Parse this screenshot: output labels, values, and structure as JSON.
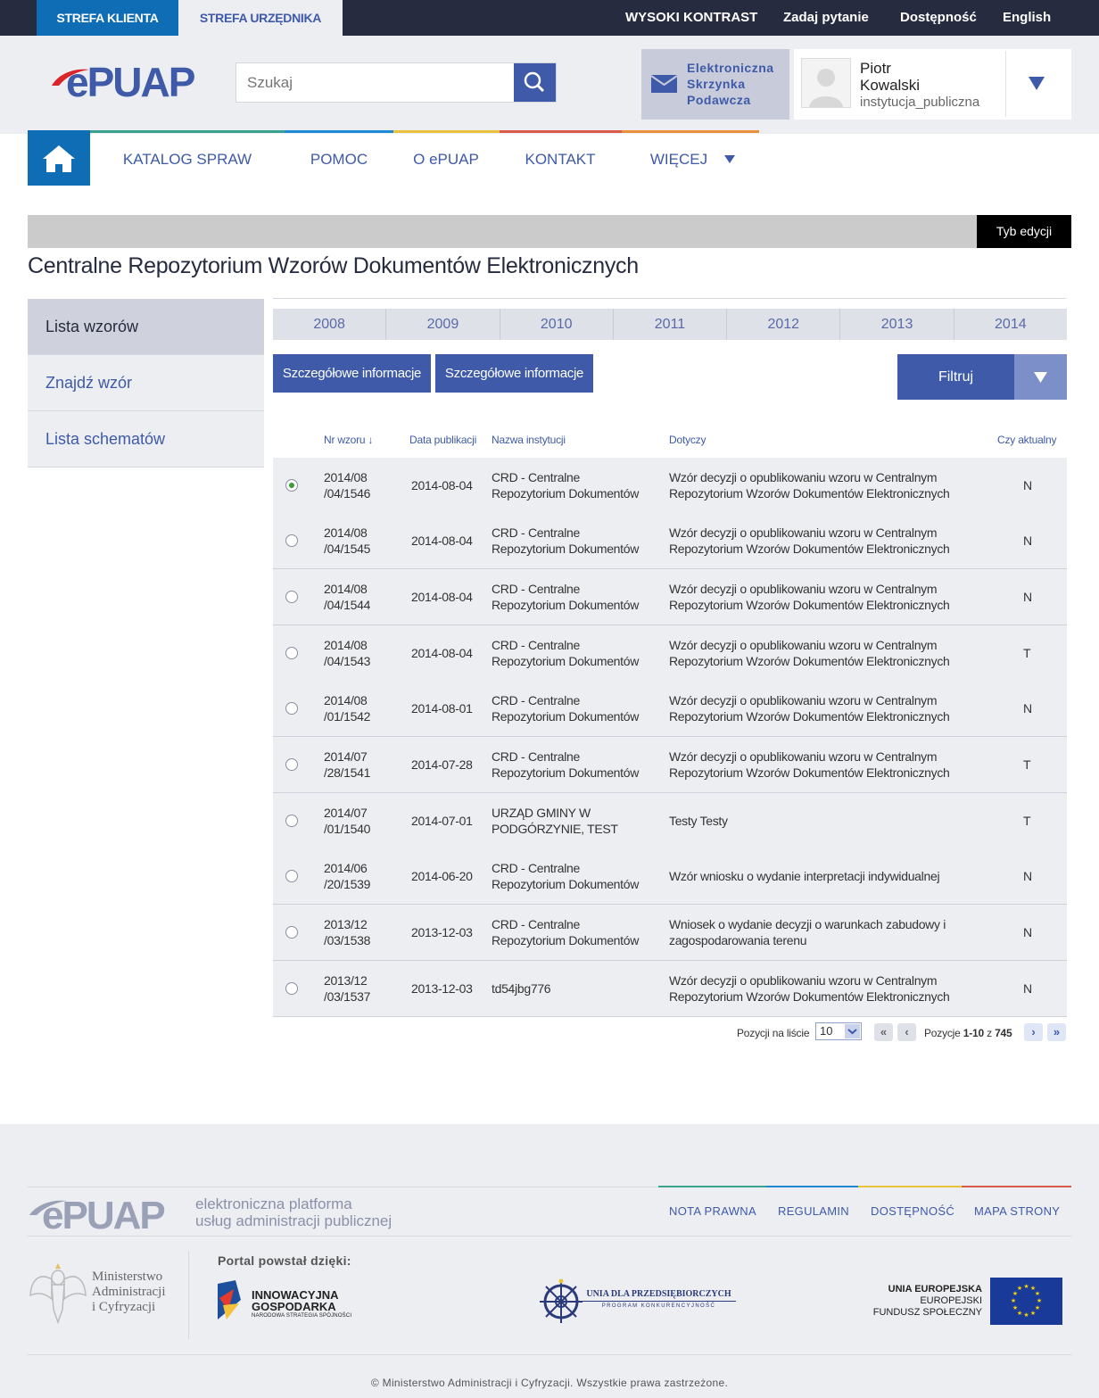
{
  "topbar": {
    "client_zone": "STREFA KLIENTA",
    "official_zone": "STREFA URZĘDNIKA",
    "high_contrast": "WYSOKI KONTRAST",
    "ask_question": "Zadaj pytanie",
    "accessibility": "Dostępność",
    "english": "English"
  },
  "header": {
    "search_placeholder": "Szukaj",
    "inbox_line1": "Elektroniczna",
    "inbox_line2": "Skrzynka",
    "inbox_line3": "Podawcza",
    "user_first": "Piotr",
    "user_last": "Kowalski",
    "user_role": "instytucja_publiczna"
  },
  "nav": {
    "items": [
      "KATALOG SPRAW",
      "POMOC",
      "O ePUAP",
      "KONTAKT",
      "WIĘCEJ"
    ]
  },
  "edit_mode": "Tyb edycji",
  "page_title": "Centralne Repozytorium Wzorów Dokumentów Elektronicznych",
  "sidebar": [
    "Lista wzorów",
    "Znajdź wzór",
    "Lista schematów"
  ],
  "years": [
    "2008",
    "2009",
    "2010",
    "2011",
    "2012",
    "2013",
    "2014"
  ],
  "buttons": {
    "details1": "Szczegółowe informacje",
    "details2": "Szczegółowe informacje",
    "filter": "Filtruj"
  },
  "table": {
    "headers": [
      "Nr wzoru ↓",
      "Data publikacji",
      "Nazwa instytucji",
      "Dotyczy",
      "Czy aktualny"
    ],
    "rows": [
      {
        "nr1": "2014/08",
        "nr2": "/04/1546",
        "date": "2014-08-04",
        "inst1": "CRD - Centralne",
        "inst2": "Repozytorium Dokumentów",
        "sub1": "Wzór decyzji o opublikowaniu wzoru w Centralnym",
        "sub2": "Repozytorium Wzorów Dokumentów Elektronicznych",
        "current": "N",
        "selected": true
      },
      {
        "nr1": "2014/08",
        "nr2": "/04/1545",
        "date": "2014-08-04",
        "inst1": "CRD - Centralne",
        "inst2": "Repozytorium Dokumentów",
        "sub1": "Wzór decyzji o opublikowaniu wzoru w Centralnym",
        "sub2": "Repozytorium Wzorów Dokumentów Elektronicznych",
        "current": "N"
      },
      {
        "nr1": "2014/08",
        "nr2": "/04/1544",
        "date": "2014-08-04",
        "inst1": "CRD - Centralne",
        "inst2": "Repozytorium Dokumentów",
        "sub1": "Wzór decyzji o opublikowaniu wzoru w Centralnym",
        "sub2": "Repozytorium Wzorów Dokumentów Elektronicznych",
        "current": "N"
      },
      {
        "nr1": "2014/08",
        "nr2": "/04/1543",
        "date": "2014-08-04",
        "inst1": "CRD - Centralne",
        "inst2": "Repozytorium Dokumentów",
        "sub1": "Wzór decyzji o opublikowaniu wzoru w Centralnym",
        "sub2": "Repozytorium Wzorów Dokumentów Elektronicznych",
        "current": "T"
      },
      {
        "nr1": "2014/08",
        "nr2": "/01/1542",
        "date": "2014-08-01",
        "inst1": "CRD - Centralne",
        "inst2": "Repozytorium Dokumentów",
        "sub1": "Wzór decyzji o opublikowaniu wzoru w Centralnym",
        "sub2": "Repozytorium Wzorów Dokumentów Elektronicznych",
        "current": "N"
      },
      {
        "nr1": "2014/07",
        "nr2": "/28/1541",
        "date": "2014-07-28",
        "inst1": "CRD - Centralne",
        "inst2": "Repozytorium Dokumentów",
        "sub1": "Wzór decyzji o opublikowaniu wzoru w Centralnym",
        "sub2": "Repozytorium Wzorów Dokumentów Elektronicznych",
        "current": "T"
      },
      {
        "nr1": "2014/07",
        "nr2": "/01/1540",
        "date": "2014-07-01",
        "inst1": "URZĄD GMINY W",
        "inst2": "PODGÓRZYNIE, TEST",
        "sub1": "Testy Testy",
        "sub2": "",
        "current": "T"
      },
      {
        "nr1": "2014/06",
        "nr2": "/20/1539",
        "date": "2014-06-20",
        "inst1": "CRD - Centralne",
        "inst2": "Repozytorium Dokumentów",
        "sub1": "Wzór wniosku o wydanie interpretacji indywidualnej",
        "sub2": "",
        "current": "N"
      },
      {
        "nr1": "2013/12",
        "nr2": "/03/1538",
        "date": "2013-12-03",
        "inst1": "CRD - Centralne",
        "inst2": "Repozytorium Dokumentów",
        "sub1": "Wniosek o wydanie decyzji o warunkach zabudowy i",
        "sub2": "zagospodarowania terenu",
        "current": "N"
      },
      {
        "nr1": "2013/12",
        "nr2": "/03/1537",
        "date": "2013-12-03",
        "inst1": "td54jbg776",
        "inst2": "",
        "sub1": "Wzór decyzji o opublikowaniu wzoru w Centralnym",
        "sub2": "Repozytorium Wzorów Dokumentów Elektronicznych",
        "current": "N"
      }
    ]
  },
  "pager": {
    "per_page_label": "Pozycji na liście",
    "per_page_value": "10",
    "positions_label": "Pozycje",
    "positions_range": "1-10",
    "of": "z",
    "total": "745"
  },
  "footer": {
    "tagline1": "elektroniczna platforma",
    "tagline2": "usług administracji publicznej",
    "links": [
      "NOTA PRAWNA",
      "REGULAMIN",
      "DOSTĘPNOŚĆ",
      "MAPA STRONY"
    ],
    "ministry1": "Ministerstwo",
    "ministry2": "Administracji",
    "ministry3": "i Cyfryzacji",
    "portal_label": "Portal powstał dzięki:",
    "ig1": "INNOWACYJNA",
    "ig2": "GOSPODARKA",
    "ig3": "NARODOWA STRATEGIA SPÓJNOŚCI",
    "udp1": "UNIA DLA PRZEDSIĘBIORCZYCH",
    "udp2": "PROGRAM KONKURENCYJNOŚĆ",
    "eu1": "UNIA EUROPEJSKA",
    "eu2": "EUROPEJSKI",
    "eu3": "FUNDUSZ SPOŁECZNY",
    "copyright": "© Ministerstwo Administracji i Cyfryzacji. Wszystkie prawa zastrzeżone."
  },
  "colors": {
    "primary_blue": "#3e5aa8",
    "client_blue": "#0f6db5",
    "dark_navy": "#262b3f",
    "nav_green": "#3aa38f",
    "nav_blue": "#1e8ad6",
    "nav_yellow": "#e8c23a",
    "nav_red": "#d95a4a",
    "nav_orange": "#e8913a"
  }
}
